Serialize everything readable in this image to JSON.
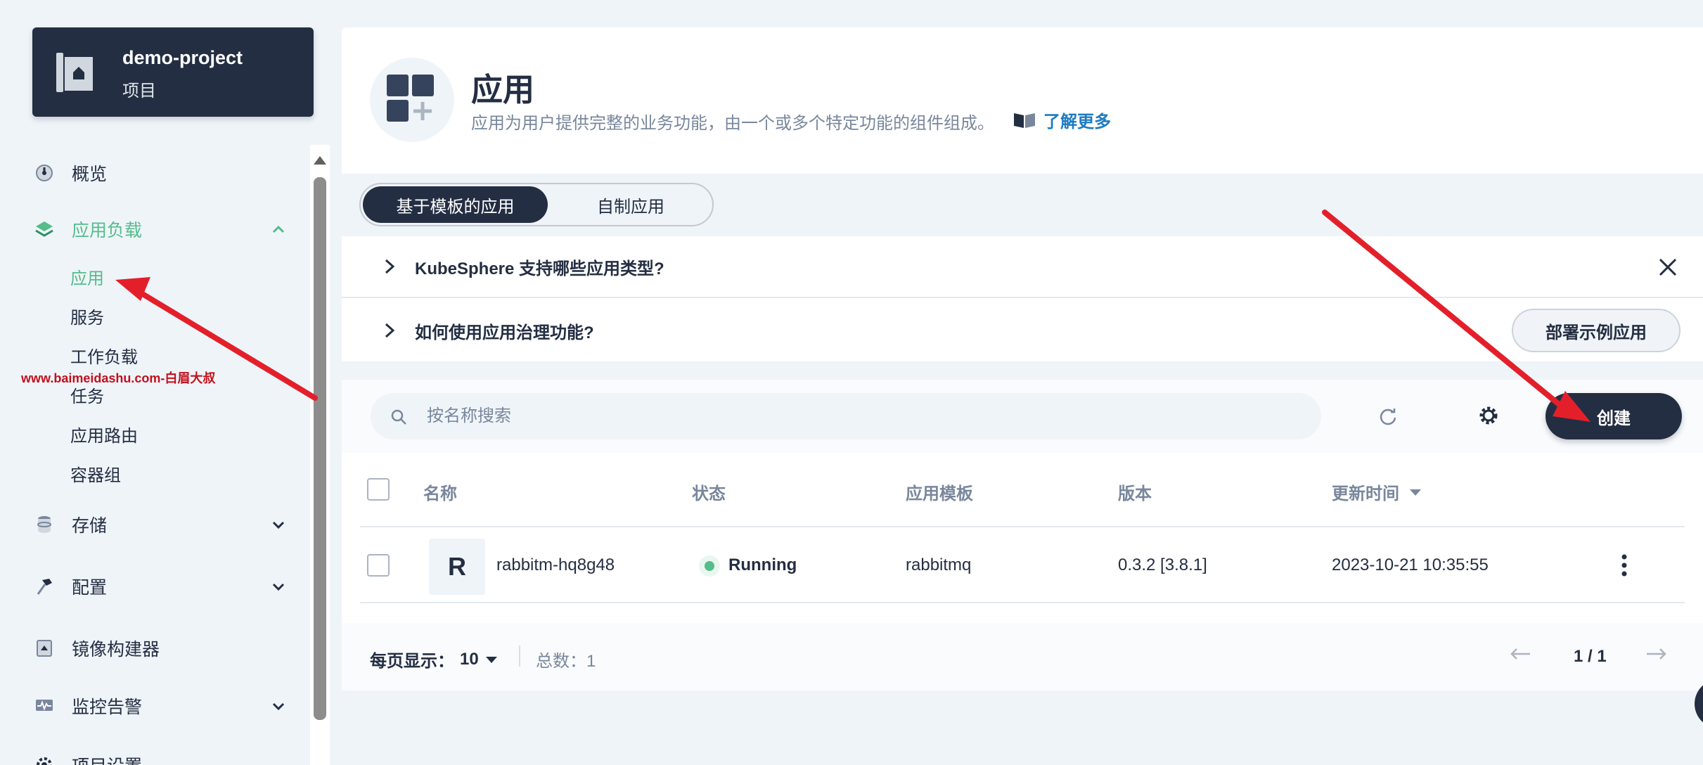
{
  "project": {
    "name": "demo-project",
    "type": "项目"
  },
  "sidebar": {
    "items": [
      {
        "label": "概览",
        "icon": "dashboard-icon"
      },
      {
        "label": "应用负载",
        "icon": "layers-icon",
        "active": true
      },
      {
        "label": "存储",
        "icon": "database-icon"
      },
      {
        "label": "配置",
        "icon": "hammer-icon"
      },
      {
        "label": "镜像构建器",
        "icon": "image-builder-icon"
      },
      {
        "label": "监控告警",
        "icon": "monitor-icon"
      },
      {
        "label": "项目设置",
        "icon": "settings-icon"
      }
    ],
    "subitems": [
      "应用",
      "服务",
      "工作负载",
      "任务",
      "应用路由",
      "容器组"
    ]
  },
  "watermark": "www.baimeidashu.com-白眉大叔",
  "header": {
    "title": "应用",
    "description": "应用为用户提供完整的业务功能，由一个或多个特定功能的组件组成。",
    "learn_more": "了解更多"
  },
  "tabs": [
    "基于模板的应用",
    "自制应用"
  ],
  "faq": {
    "q1": "KubeSphere 支持哪些应用类型?",
    "q2": "如何使用应用治理功能?",
    "deploy_sample": "部署示例应用"
  },
  "toolbar": {
    "search_placeholder": "按名称搜索",
    "create_label": "创建"
  },
  "table": {
    "columns": [
      "名称",
      "状态",
      "应用模板",
      "版本",
      "更新时间"
    ],
    "rows": [
      {
        "avatar": "R",
        "name": "rabbitm-hq8g48",
        "status": "Running",
        "template": "rabbitmq",
        "version": "0.3.2 [3.8.1]",
        "updated": "2023-10-21 10:35:55"
      }
    ]
  },
  "pagination": {
    "per_page_label": "每页显示：",
    "per_page_value": "10",
    "total_label": "总数：",
    "total_value": "1",
    "page_indicator": "1 / 1"
  },
  "colors": {
    "primary_dark": "#242e42",
    "accent_green": "#55bc8a",
    "link_blue": "#1d7bc2",
    "annotation_red": "#e3202a",
    "background": "#eff4f9"
  }
}
